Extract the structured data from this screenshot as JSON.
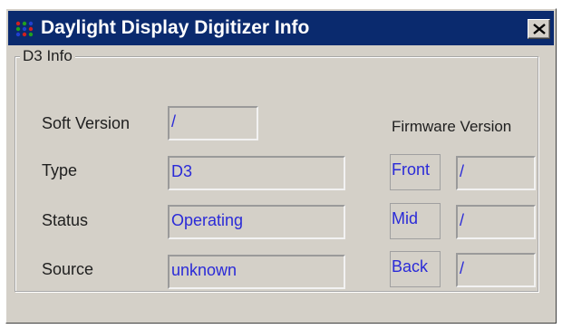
{
  "window": {
    "title": "Daylight Display Digitizer Info",
    "icon": "app-dots-icon",
    "close_icon": "close-icon",
    "colors": {
      "titlebar": "#0a2a6e",
      "face": "#d4d0c8",
      "value_text": "#2a2ad8"
    }
  },
  "group": {
    "label": "D3 Info"
  },
  "fields": {
    "soft_version": {
      "label": "Soft Version",
      "value": "/"
    },
    "type": {
      "label": "Type",
      "value": "D3"
    },
    "status": {
      "label": "Status",
      "value": "Operating"
    },
    "source": {
      "label": "Source",
      "value": "unknown"
    }
  },
  "firmware": {
    "heading": "Firmware Version",
    "rows": [
      {
        "label": "Front",
        "value": "/"
      },
      {
        "label": "Mid",
        "value": "/"
      },
      {
        "label": "Back",
        "value": "/"
      }
    ]
  }
}
